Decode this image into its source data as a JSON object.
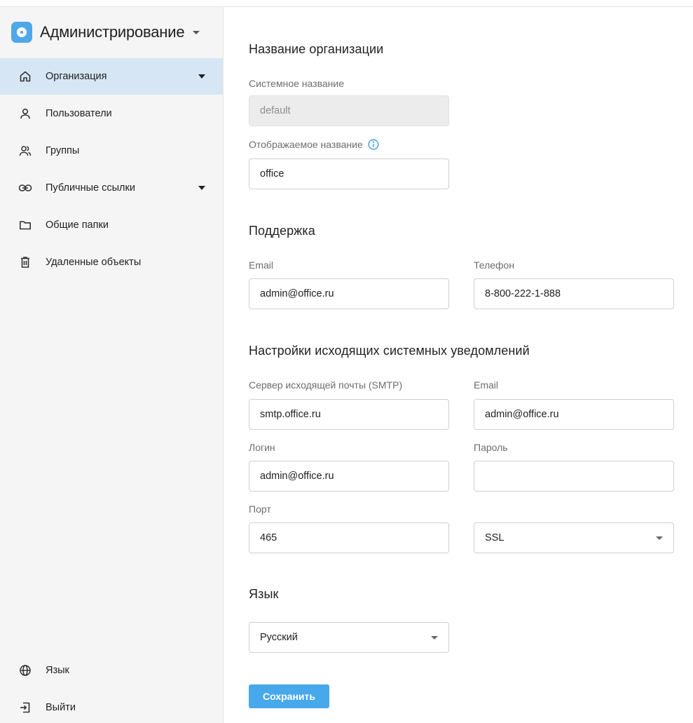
{
  "sidebar": {
    "brand": {
      "title": "Администрирование"
    },
    "items": [
      {
        "label": "Организация",
        "icon": "home-icon",
        "active": true,
        "has_caret": true
      },
      {
        "label": "Пользователи",
        "icon": "user-icon"
      },
      {
        "label": "Группы",
        "icon": "group-icon"
      },
      {
        "label": "Публичные ссылки",
        "icon": "link-icon",
        "has_caret": true
      },
      {
        "label": "Общие папки",
        "icon": "folder-icon"
      },
      {
        "label": "Удаленные объекты",
        "icon": "trash-icon"
      }
    ],
    "bottom": [
      {
        "label": "Язык",
        "icon": "globe-icon"
      },
      {
        "label": "Выйти",
        "icon": "logout-icon"
      }
    ]
  },
  "org": {
    "title": "Название организации",
    "system_name_label": "Системное название",
    "system_name_value": "default",
    "display_name_label": "Отображаемое название",
    "display_name_value": "office"
  },
  "support": {
    "title": "Поддержка",
    "email_label": "Email",
    "email_value": "admin@office.ru",
    "phone_label": "Телефон",
    "phone_value": "8-800-222-1-888"
  },
  "notifications": {
    "title": "Настройки исходящих системных уведомлений",
    "smtp_label": "Сервер исходящей почты (SMTP)",
    "smtp_value": "smtp.office.ru",
    "email_label": "Email",
    "email_value": "admin@office.ru",
    "login_label": "Логин",
    "login_value": "admin@office.ru",
    "password_label": "Пароль",
    "password_value": "",
    "port_label": "Порт",
    "port_value": "465",
    "security_value": "SSL"
  },
  "language": {
    "title": "Язык",
    "value": "Русский"
  },
  "actions": {
    "save_label": "Сохранить"
  },
  "colors": {
    "accent": "#48a8ec",
    "active_nav_bg": "#d6e6f5",
    "sidebar_bg": "#f5f5f5"
  }
}
